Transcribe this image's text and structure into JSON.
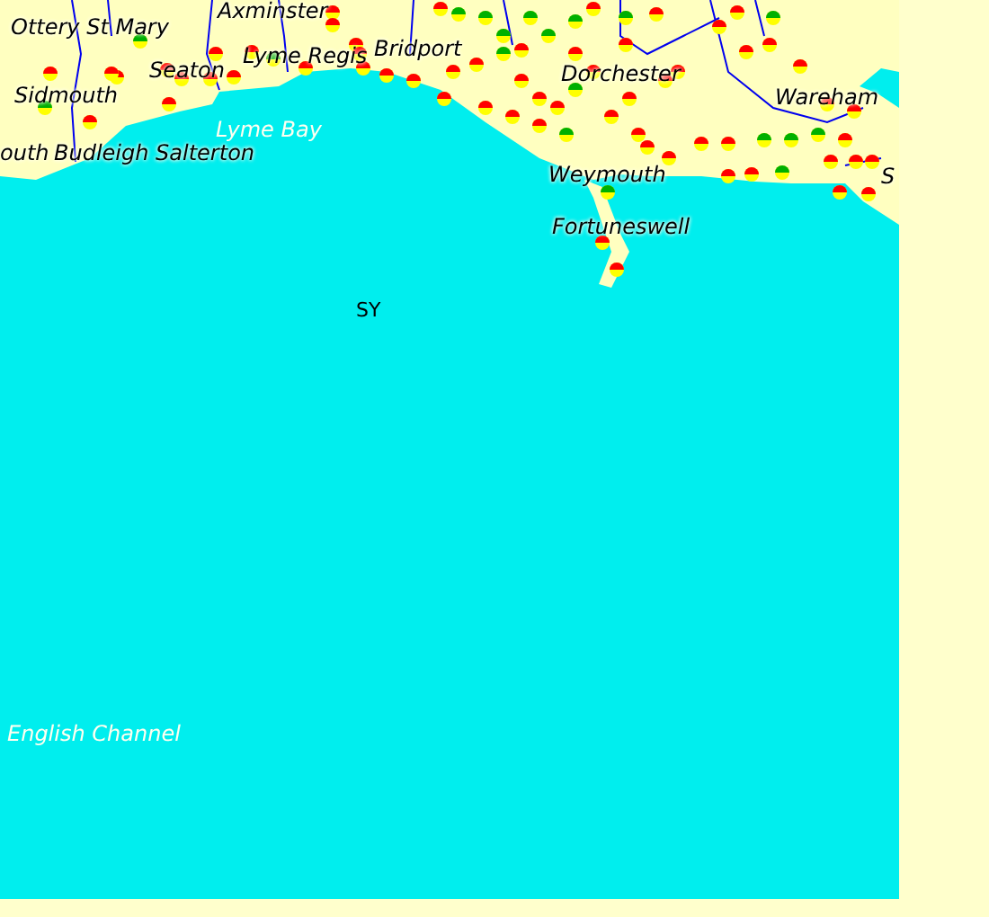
{
  "map": {
    "labels": [
      {
        "text": "Axminster",
        "kind": "town"
      },
      {
        "text": "Ottery St Mary",
        "kind": "town"
      },
      {
        "text": "Bridport",
        "kind": "town"
      },
      {
        "text": "Lyme Regis",
        "kind": "town"
      },
      {
        "text": "Seaton",
        "kind": "town"
      },
      {
        "text": "Dorchester",
        "kind": "town"
      },
      {
        "text": "Sidmouth",
        "kind": "town"
      },
      {
        "text": "Wareham",
        "kind": "town"
      },
      {
        "text": "Lyme Bay",
        "kind": "water"
      },
      {
        "text": "outh",
        "kind": "town"
      },
      {
        "text": "Budleigh Salterton",
        "kind": "town"
      },
      {
        "text": "Weymouth",
        "kind": "town"
      },
      {
        "text": "S",
        "kind": "town"
      },
      {
        "text": "Fortuneswell",
        "kind": "town"
      },
      {
        "text": "SY",
        "kind": "grid"
      },
      {
        "text": "English Channel",
        "kind": "water"
      }
    ]
  }
}
